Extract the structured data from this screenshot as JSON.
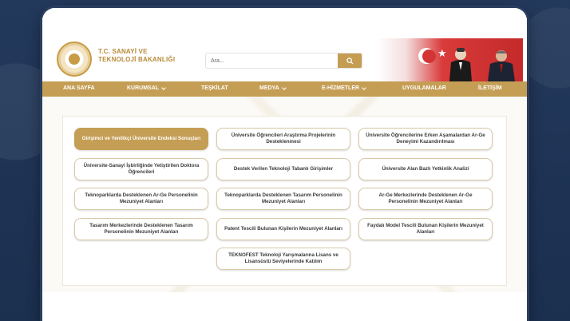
{
  "header": {
    "brand_line1": "T.C. SANAYİ VE",
    "brand_line2": "TEKNOLOJİ BAKANLIĞI"
  },
  "search": {
    "placeholder": "Ara...",
    "icon": "search-icon"
  },
  "nav": {
    "items": [
      {
        "label": "ANA SAYFA",
        "dropdown": false
      },
      {
        "label": "KURUMSAL",
        "dropdown": true
      },
      {
        "label": "TEŞKİLAT",
        "dropdown": false
      },
      {
        "label": "MEDYA",
        "dropdown": true
      },
      {
        "label": "E-HİZMETLER",
        "dropdown": true
      },
      {
        "label": "UYGULAMALAR",
        "dropdown": false
      },
      {
        "label": "İLETİŞİM",
        "dropdown": false
      }
    ]
  },
  "cards": [
    {
      "label": "Girişimci ve Yenilikçi Üniversite Endeksi Sonuçları",
      "active": true
    },
    {
      "label": "Üniversite Öğrencileri Araştırma Projelerinin Desteklenmesi",
      "active": false
    },
    {
      "label": "Üniversite Öğrencilerine Erken Aşamalardan Ar-Ge Deneyimi Kazandırılması",
      "active": false
    },
    {
      "label": "Üniversite-Sanayi İşbirliğinde Yetiştirilen Doktora Öğrencileri",
      "active": false
    },
    {
      "label": "Destek Verilen Teknoloji Tabanlı Girişimler",
      "active": false
    },
    {
      "label": "Üniversite Alan Bazlı Yetkinlik Analizi",
      "active": false
    },
    {
      "label": "Teknoparklarda Desteklenen Ar-Ge Personelinin Mezuniyet Alanları",
      "active": false
    },
    {
      "label": "Teknoparklarda Desteklenen Tasarım Personelinin Mezuniyet Alanları",
      "active": false
    },
    {
      "label": "Ar-Ge Merkezlerinde Desteklenen Ar-Ge Personelinin Mezuniyet Alanları",
      "active": false
    },
    {
      "label": "Tasarım Merkezlerinde Desteklenen Tasarım Personelinin Mezuniyet Alanları",
      "active": false
    },
    {
      "label": "Patent Tescili Bulunan Kişilerin Mezuniyet Alanları",
      "active": false
    },
    {
      "label": "Faydalı Model Tescili Bulunan Kişilerin Mezuniyet Alanları",
      "active": false
    },
    {
      "label": "TEKNOFEST Teknoloji Yarışmalarına Lisans ve Lisansüstü Seviyelerinde Katılım",
      "active": false
    }
  ],
  "colors": {
    "accent": "#c59e55",
    "background": "#1f3556"
  }
}
